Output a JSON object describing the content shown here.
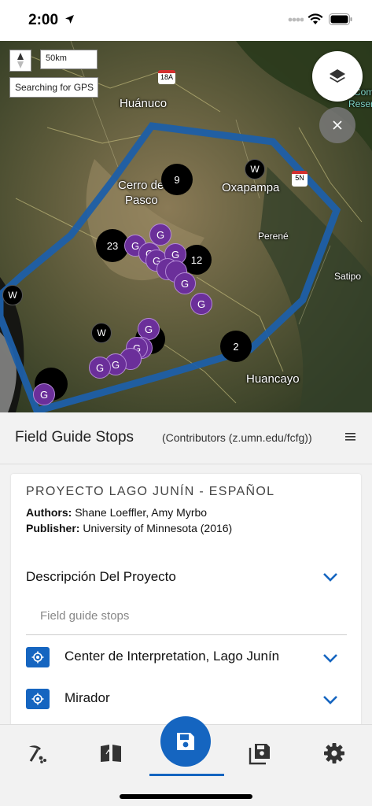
{
  "status_bar": {
    "time": "2:00"
  },
  "map": {
    "scale": "50km",
    "gps_status": "Searching for GPS",
    "places": [
      {
        "name": "Huánuco"
      },
      {
        "name": "Cerro de"
      },
      {
        "name": "Pasco"
      },
      {
        "name": "Oxapampa"
      },
      {
        "name": "Perené"
      },
      {
        "name": "Satipo"
      },
      {
        "name": "Huancayo"
      }
    ],
    "road_shields": [
      "18A",
      "5N"
    ],
    "edge_text": [
      "Com",
      "Reserv"
    ],
    "clusters": [
      "9",
      "23",
      "12",
      "2"
    ],
    "guide_marker": "G",
    "waypoint_marker": "W"
  },
  "sheet": {
    "title": "Field Guide Stops",
    "contributors": "(Contributors (z.umn.edu/fcfg))"
  },
  "card": {
    "project_title": "PROYECTO LAGO JUNÍN - ESPAÑOL",
    "authors_label": "Authors:",
    "authors_value": " Shane Loeffler, Amy Myrbo",
    "publisher_label": "Publisher:",
    "publisher_value": " University of Minnesota (2016)",
    "description_label": "Descripción Del Proyecto",
    "section_subtitle": "Field guide stops",
    "stops": [
      {
        "label": "Center de Interpretation, Lago Junín"
      },
      {
        "label": "Mirador"
      }
    ]
  },
  "colors": {
    "accent": "#1565c0",
    "guide_marker": "#6b2f9a",
    "boundary": "#1e5fa8"
  },
  "tabs": [
    {
      "icon": "pick-hammer-icon"
    },
    {
      "icon": "book-map-icon"
    },
    {
      "icon": "save-icon"
    },
    {
      "icon": "saved-maps-icon"
    },
    {
      "icon": "settings-gear-icon"
    }
  ]
}
